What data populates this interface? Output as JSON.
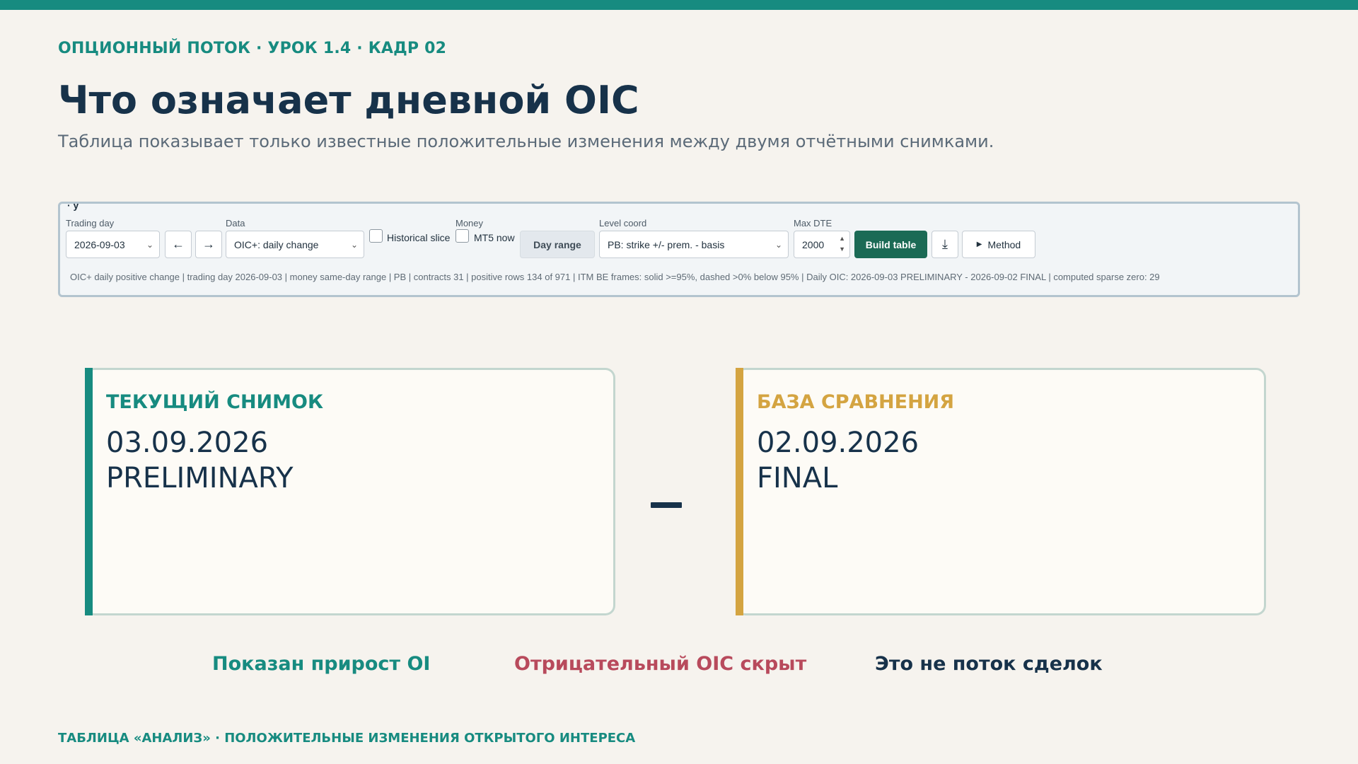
{
  "header": {
    "kicker": "ОПЦИОННЫЙ ПОТОК · УРОК 1.4 · КАДР 02",
    "title": "Что означает дневной OIC",
    "subtitle": "Таблица показывает только известные положительные изменения между двумя отчётными снимками."
  },
  "panel": {
    "clipped_heading": "· y",
    "trading_day": {
      "label": "Trading day",
      "value": "2026-09-03"
    },
    "data": {
      "label": "Data",
      "value": "OIC+: daily change"
    },
    "historical_slice": {
      "label": "Historical slice",
      "checked": false
    },
    "money": {
      "label": "Money",
      "mt5_label": "MT5 now",
      "mt5_checked": false,
      "day_range_label": "Day range"
    },
    "level_coord": {
      "label": "Level coord",
      "value": "PB: strike +/- prem. - basis"
    },
    "max_dte": {
      "label": "Max DTE",
      "value": "2000"
    },
    "build_label": "Build table",
    "method_label": "Method",
    "icons": {
      "prev": "arrow-left-icon",
      "next": "arrow-right-icon",
      "download": "download-icon",
      "method": "caret-right-icon"
    },
    "status": "OIC+ daily positive change | trading day 2026-09-03 | money same-day range | PB | contracts 31 | positive rows 134 of 971 | ITM BE frames: solid >=95%, dashed >0% below 95% | Daily OIC: 2026-09-03 PRELIMINARY - 2026-09-02 FINAL | computed sparse zero: 29"
  },
  "cards": {
    "current": {
      "label": "ТЕКУЩИЙ СНИМОК",
      "date": "03.09.2026",
      "status": "PRELIMINARY",
      "accent": "#178b80"
    },
    "base": {
      "label": "БАЗА СРАВНЕНИЯ",
      "date": "02.09.2026",
      "status": "FINAL",
      "accent": "#d4a441"
    }
  },
  "points": {
    "growth": "Показан прирост OI",
    "negative": "Отрицательный OIC скрыт",
    "not_flow": "Это не поток сделок"
  },
  "footer": "ТАБЛИЦА «АНАЛИЗ» · ПОЛОЖИТЕЛЬНЫЕ ИЗМЕНЕНИЯ ОТКРЫТОГО ИНТЕРЕСА",
  "colors": {
    "teal": "#178b80",
    "gold": "#d4a441",
    "red": "#b84a5c",
    "navy": "#17324a"
  }
}
